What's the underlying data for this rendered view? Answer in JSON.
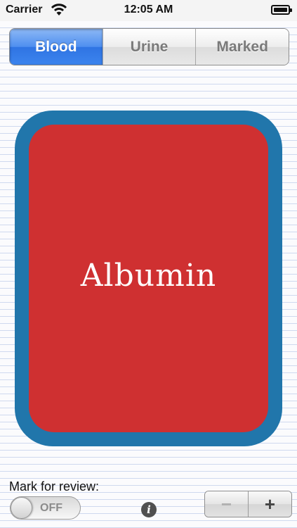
{
  "status_bar": {
    "carrier": "Carrier",
    "time": "12:05 AM"
  },
  "segments": [
    "Blood",
    "Urine",
    "Marked"
  ],
  "selected_segment": "Blood",
  "card": {
    "term": "Albumin",
    "border_color": "#2176ab",
    "fill_color": "#cf3031"
  },
  "review": {
    "label": "Mark for review:",
    "toggle_state": "OFF"
  },
  "info": {
    "icon_glyph": "i"
  },
  "stepper": {
    "minus": "−",
    "plus": "+"
  },
  "icons": [
    "wifi-icon",
    "battery-icon",
    "info-icon"
  ]
}
